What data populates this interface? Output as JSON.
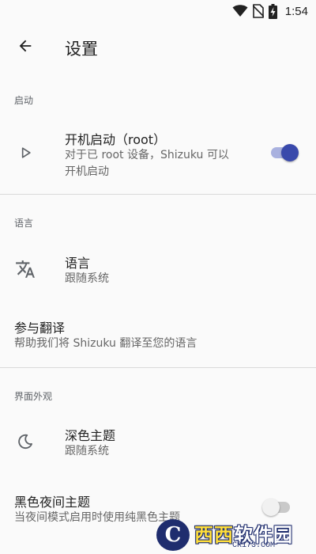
{
  "status_bar": {
    "time": "1:54",
    "icons": [
      "wifi-icon",
      "no-sim-icon",
      "battery-charging-icon"
    ]
  },
  "app_bar": {
    "title": "设置"
  },
  "sections": {
    "startup": {
      "header": "启动",
      "boot": {
        "title": "开机启动（root）",
        "summary_line1": "对于已 root 设备，Shizuku 可以",
        "summary_line2": "开机启动",
        "enabled": true
      }
    },
    "language": {
      "header": "语言",
      "language_item": {
        "title": "语言",
        "summary": "跟随系统"
      },
      "translate_item": {
        "title": "参与翻译",
        "summary": "帮助我们将 Shizuku 翻译至您的语言"
      }
    },
    "appearance": {
      "header": "界面外观",
      "dark_theme": {
        "title": "深色主题",
        "summary": "跟随系统"
      },
      "black_night": {
        "title": "黑色夜间主题",
        "summary": "当夜间模式启用时使用纯黑色主题",
        "enabled": false
      }
    }
  },
  "watermark": {
    "logo_char": "C",
    "brand_prefix": "西西",
    "brand_suffix": "软件园",
    "domain": "CR173.COM"
  },
  "colors": {
    "accent": "#3949ab",
    "accent_track": "#a9b1df",
    "divider": "#dadada",
    "background": "#fafafa"
  }
}
